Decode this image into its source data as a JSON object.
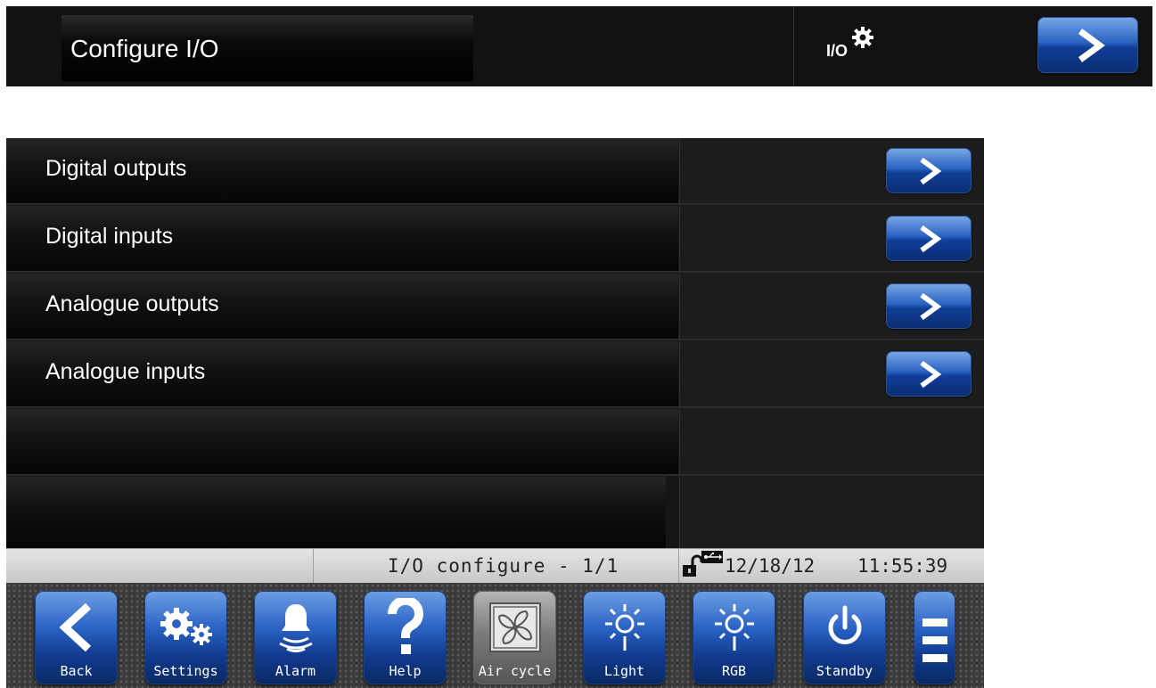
{
  "header": {
    "title": "Configure I/O",
    "icon": {
      "name": "io-settings-icon",
      "text": "I/O"
    },
    "next_button_icon": "chevron-right-icon"
  },
  "menu": {
    "items": [
      {
        "label": "Digital outputs",
        "has_button": true
      },
      {
        "label": "Digital inputs",
        "has_button": true
      },
      {
        "label": "Analogue outputs",
        "has_button": true
      },
      {
        "label": "Analogue inputs",
        "has_button": true
      },
      {
        "label": "",
        "has_button": false
      },
      {
        "label": "",
        "has_button": false
      }
    ]
  },
  "status": {
    "page": "I/O configure - 1/1",
    "date": "12/18/12",
    "time": "11:55:39",
    "icons": [
      "unlocked-padlock-icon",
      "usb-icon"
    ]
  },
  "toolbar": {
    "buttons": [
      {
        "label": "Back",
        "icon": "back-arrow-icon"
      },
      {
        "label": "Settings",
        "icon": "gears-icon"
      },
      {
        "label": "Alarm",
        "icon": "bell-icon"
      },
      {
        "label": "Help",
        "icon": "question-icon"
      },
      {
        "label": "Air cycle",
        "icon": "fan-icon"
      },
      {
        "label": "Light",
        "icon": "sun-icon"
      },
      {
        "label": "RGB",
        "icon": "sun-icon"
      },
      {
        "label": "Standby",
        "icon": "power-icon"
      },
      {
        "label": "",
        "icon": "hamburger-menu-icon"
      }
    ]
  },
  "colors": {
    "accent_blue": "#2a63c2",
    "background_dark": "#121212",
    "status_bar": "#d6d6d6"
  }
}
